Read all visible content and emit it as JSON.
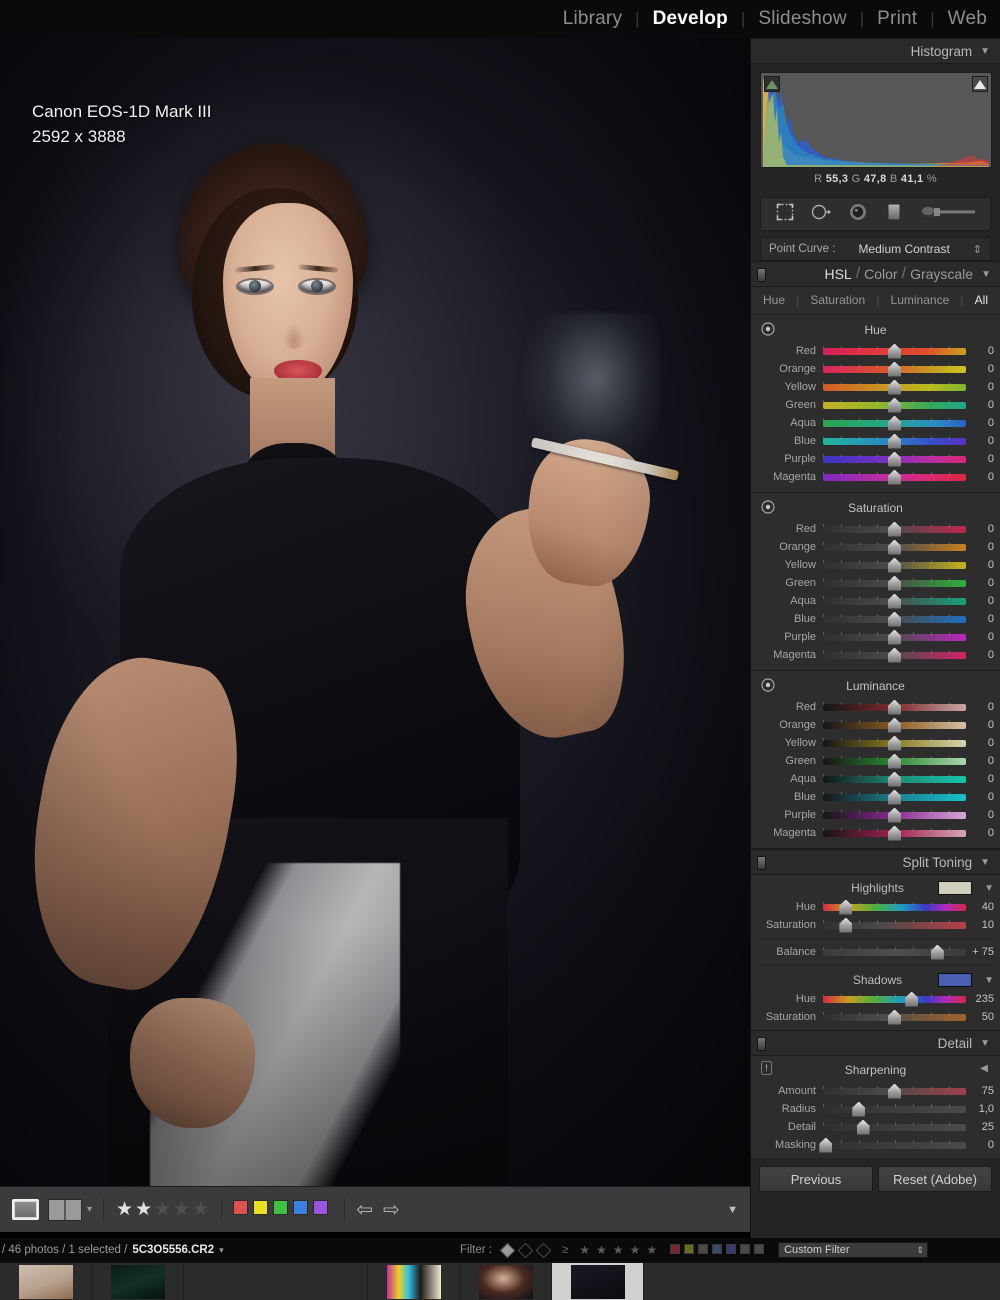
{
  "topbar": {
    "modules": [
      {
        "label": "Library",
        "active": false
      },
      {
        "label": "Develop",
        "active": true
      },
      {
        "label": "Slideshow",
        "active": false
      },
      {
        "label": "Print",
        "active": false
      },
      {
        "label": "Web",
        "active": false
      }
    ],
    "separator": "|"
  },
  "image_overlay": {
    "camera": "Canon EOS-1D Mark III",
    "dimensions": "2592 x 3888"
  },
  "histogram": {
    "title": "Histogram",
    "collapse_glyph": "▼",
    "readout": {
      "r_label": "R",
      "r": "55,3",
      "g_label": "G",
      "g": "47,8",
      "b_label": "B",
      "b": "41,1",
      "unit": "%"
    }
  },
  "tools": {
    "items": [
      "crop-overlay-tool",
      "spot-removal-tool",
      "red-eye-tool",
      "graduated-filter-tool",
      "adjustment-brush-tool"
    ]
  },
  "point_curve": {
    "label": "Point Curve :",
    "value": "Medium Contrast",
    "stepper": "⇕"
  },
  "hsl": {
    "header": {
      "hsl": "HSL",
      "sep": "/",
      "color": "Color",
      "grayscale": "Grayscale",
      "collapse_glyph": "▼"
    },
    "tabs": [
      {
        "label": "Hue",
        "active": false
      },
      {
        "label": "Saturation",
        "active": false
      },
      {
        "label": "Luminance",
        "active": false
      },
      {
        "label": "All",
        "active": true
      }
    ],
    "tab_divider": "|",
    "groups": [
      {
        "title": "Hue",
        "target_icon": "target-adjust-icon",
        "rows": [
          {
            "name": "Red",
            "value": "0",
            "pos": 50,
            "track": "linear-gradient(90deg,#d81e5b 0%,#e03a3a 40%,#e04a2a 70%,#c8a21e 100%)"
          },
          {
            "name": "Orange",
            "value": "0",
            "pos": 50,
            "track": "linear-gradient(90deg,#d8245e 0%,#d9582b 45%,#c79a22 75%,#c8c820 100%)"
          },
          {
            "name": "Yellow",
            "value": "0",
            "pos": 50,
            "track": "linear-gradient(90deg,#d45a26 0%,#c79a22 45%,#b7bb22 75%,#7fb52a 100%)"
          },
          {
            "name": "Green",
            "value": "0",
            "pos": 50,
            "track": "linear-gradient(90deg,#c6b022 0%,#8fb82a 40%,#34a95a 75%,#20a88a 100%)"
          },
          {
            "name": "Aqua",
            "value": "0",
            "pos": 50,
            "track": "linear-gradient(90deg,#2ca54a 0%,#20a790 48%,#2b8fc0 78%,#2c5fc9 100%)"
          },
          {
            "name": "Blue",
            "value": "0",
            "pos": 50,
            "track": "linear-gradient(90deg,#20b69a 0%,#2b86c4 45%,#3352c6 75%,#5a2fc2 100%)"
          },
          {
            "name": "Purple",
            "value": "0",
            "pos": 50,
            "track": "linear-gradient(90deg,#3a36bf 0%,#7a2fc0 45%,#bf2da0 78%,#d62873 100%)"
          },
          {
            "name": "Magenta",
            "value": "0",
            "pos": 50,
            "track": "linear-gradient(90deg,#7b2bbe 0%,#bf2ba4 40%,#d92a74 72%,#d8283f 100%)"
          }
        ]
      },
      {
        "title": "Saturation",
        "target_icon": "target-adjust-icon",
        "rows": [
          {
            "name": "Red",
            "value": "0",
            "pos": 50,
            "track": "linear-gradient(90deg,#2f2f2f 0%,#4a4a4a 48%,#c0264e 100%)"
          },
          {
            "name": "Orange",
            "value": "0",
            "pos": 50,
            "track": "linear-gradient(90deg,#2f2f2f 0%,#4a4a4a 48%,#c8801e 100%)"
          },
          {
            "name": "Yellow",
            "value": "0",
            "pos": 50,
            "track": "linear-gradient(90deg,#2f2f2f 0%,#4a4a4a 48%,#c8b41c 100%)"
          },
          {
            "name": "Green",
            "value": "0",
            "pos": 50,
            "track": "linear-gradient(90deg,#2f2f2f 0%,#4a4a4a 48%,#2fae3a 100%)"
          },
          {
            "name": "Aqua",
            "value": "0",
            "pos": 50,
            "track": "linear-gradient(90deg,#2f2f2f 0%,#4a4a4a 48%,#16a07c 100%)"
          },
          {
            "name": "Blue",
            "value": "0",
            "pos": 50,
            "track": "linear-gradient(90deg,#2f2f2f 0%,#4a4a4a 48%,#1f6fbf 100%)"
          },
          {
            "name": "Purple",
            "value": "0",
            "pos": 50,
            "track": "linear-gradient(90deg,#2f2f2f 0%,#4a4a4a 48%,#bb28bd 100%)"
          },
          {
            "name": "Magenta",
            "value": "0",
            "pos": 50,
            "track": "linear-gradient(90deg,#2f2f2f 0%,#4a4a4a 48%,#d42468 100%)"
          }
        ]
      },
      {
        "title": "Luminance",
        "target_icon": "target-adjust-icon",
        "rows": [
          {
            "name": "Red",
            "value": "0",
            "pos": 50,
            "track": "linear-gradient(90deg,#151515 0%,#7a2a2a 50%,#c9a6a6 100%)"
          },
          {
            "name": "Orange",
            "value": "0",
            "pos": 50,
            "track": "linear-gradient(90deg,#151515 0%,#8a5a22 50%,#d6c0a2 100%)"
          },
          {
            "name": "Yellow",
            "value": "0",
            "pos": 50,
            "track": "linear-gradient(90deg,#151515 0%,#8a7c22 50%,#d8d2b0 100%)"
          },
          {
            "name": "Green",
            "value": "0",
            "pos": 50,
            "track": "linear-gradient(90deg,#151515 0%,#2a8a30 50%,#aed6b0 100%)"
          },
          {
            "name": "Aqua",
            "value": "0",
            "pos": 50,
            "track": "linear-gradient(90deg,#151515 0%,#1d8a74 50%,#16c4aa 100%)"
          },
          {
            "name": "Blue",
            "value": "0",
            "pos": 50,
            "track": "linear-gradient(90deg,#151515 0%,#1a7e8e 50%,#18c0c8 100%)"
          },
          {
            "name": "Purple",
            "value": "0",
            "pos": 50,
            "track": "linear-gradient(90deg,#151515 0%,#8a2a8e 50%,#d6a8d8 100%)"
          },
          {
            "name": "Magenta",
            "value": "0",
            "pos": 50,
            "track": "linear-gradient(90deg,#151515 0%,#a02050 50%,#d8a8b4 100%)"
          }
        ]
      }
    ]
  },
  "split_toning": {
    "title": "Split Toning",
    "collapse_glyph": "▼",
    "highlights": {
      "label": "Highlights",
      "swatch": "#cfcdbc",
      "tri": "▼",
      "rows": [
        {
          "name": "Hue",
          "value": "40",
          "pos": 16,
          "track": "linear-gradient(90deg,#d62a46 0%,#c8a020 18%,#4fae3c 36%,#1f9cc0 55%,#3a3ac4 72%,#b02ab8 86%,#d4284c 100%)"
        },
        {
          "name": "Saturation",
          "value": "10",
          "pos": 16,
          "track": "linear-gradient(90deg,#2f2f2f 0%,#4a4a4a 40%,#b84048 100%)"
        }
      ]
    },
    "balance": {
      "name": "Balance",
      "value": "+ 75",
      "pos": 80,
      "track": "linear-gradient(90deg,#3a3a3a 0%,#4e4e4e 50%,#3a3a3a 100%)"
    },
    "shadows": {
      "label": "Shadows",
      "swatch": "#4a5fb0",
      "tri": "▼",
      "rows": [
        {
          "name": "Hue",
          "value": "235",
          "pos": 62,
          "track": "linear-gradient(90deg,#d62a46 0%,#c8a020 18%,#4fae3c 36%,#1f9cc0 55%,#3a3ac4 72%,#b02ab8 86%,#d4284c 100%)"
        },
        {
          "name": "Saturation",
          "value": "50",
          "pos": 50,
          "track": "linear-gradient(90deg,#2f2f2f 0%,#4a4a4a 40%,#a0632c 100%)"
        }
      ]
    }
  },
  "detail": {
    "title": "Detail",
    "collapse_glyph": "▼",
    "sharpening": {
      "label": "Sharpening",
      "warn_icon": "warning-icon",
      "tri": "◀",
      "rows": [
        {
          "name": "Amount",
          "value": "75",
          "pos": 50,
          "track": "linear-gradient(90deg,#2f2f2f 0%,#4a4a4a 45%,#a03f4a 100%)"
        },
        {
          "name": "Radius",
          "value": "1,0",
          "pos": 25,
          "track": "linear-gradient(90deg,#2f2f2f 0%,#4a4a4a 100%)"
        },
        {
          "name": "Detail",
          "value": "25",
          "pos": 28,
          "track": "linear-gradient(90deg,#2f2f2f 0%,#4a4a4a 100%)"
        },
        {
          "name": "Masking",
          "value": "0",
          "pos": 2,
          "track": "linear-gradient(90deg,#2f2f2f 0%,#4a4a4a 100%)"
        }
      ]
    }
  },
  "buttons": {
    "previous": "Previous",
    "reset": "Reset (Adobe)"
  },
  "toolbar": {
    "loupe_icon": "loupe-view-icon",
    "compare_icon": "compare-view-icon",
    "dropdown_glyph": "▾",
    "rating": {
      "filled": 2,
      "total": 5,
      "glyph": "★"
    },
    "color_labels": [
      "#e05050",
      "#e8e020",
      "#40c040",
      "#3a80e0",
      "#9a55e0"
    ],
    "nav": {
      "prev": "⇦",
      "next": "⇨"
    },
    "collapse_glyph": "▼"
  },
  "filmstrip_bar": {
    "count_text": "/ 46 photos / 1 selected /",
    "filename": "5C3O5556.CR2",
    "dropdown_glyph": "▾",
    "filter_label": "Filter :",
    "filter_stars": 5,
    "filter_star_glyph": "★",
    "filter_ge": "≥",
    "filter_chips": [
      "#7a2430",
      "#6a6a20",
      "#4a4a4a",
      "#3a4a68",
      "#3a3a70",
      "#4a4a4a",
      "#4a4a4a"
    ],
    "custom_filter": "Custom Filter",
    "stepper_glyph": "⇕"
  },
  "filmstrip": {
    "cells": [
      {
        "kind": "thumb",
        "style": "linear-gradient(160deg,#cdbfae 0%,#b6a18c 55%,#8e6b52 100%)",
        "wide": false
      },
      {
        "kind": "thumb",
        "style": "linear-gradient(160deg,#0c1a18 0%,#123028 50%,#071210 100%)",
        "wide": false
      },
      {
        "kind": "empty",
        "style": "",
        "wide": true
      },
      {
        "kind": "thumb",
        "style": "linear-gradient(90deg,#c030a0 0%,#f0d020 22%,#30c0e0 40%,#201a18 62%,#f0e8d0 100%)",
        "wide": false
      },
      {
        "kind": "thumb",
        "style": "radial-gradient(ellipse at 45% 40%,#d8b098 0%,#4a2a20 50%,#0c1018 100%)",
        "wide": false
      },
      {
        "kind": "selected",
        "style": "linear-gradient(160deg,#1a1a22 0%,#0a0a10 100%)",
        "wide": false
      }
    ]
  }
}
